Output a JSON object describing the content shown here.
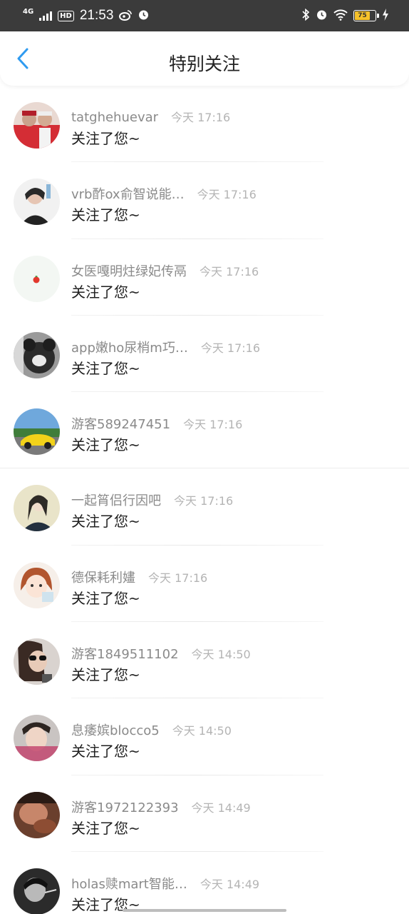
{
  "status_bar": {
    "network": "4G",
    "hd": "HD",
    "time": "21:53",
    "battery": "75"
  },
  "header": {
    "title": "特别关注",
    "back_icon": "chevron-left-icon"
  },
  "colors": {
    "accent": "#2f9bf0",
    "status_bar_bg": "#3b3b3b",
    "battery": "#f6c12a"
  },
  "items": [
    {
      "name": "tatghehuevar",
      "time": "今天 17:16",
      "message": "关注了您~"
    },
    {
      "name": "vrb酢ox俞智说能…",
      "time": "今天 17:16",
      "message": "关注了您~"
    },
    {
      "name": "女医嘎明炷绿妃传鬲",
      "time": "今天 17:16",
      "message": "关注了您~"
    },
    {
      "name": "app嫩ho尿梢m巧…",
      "time": "今天 17:16",
      "message": "关注了您~"
    },
    {
      "name": "游客589247451",
      "time": "今天 17:16",
      "message": "关注了您~"
    },
    {
      "name": "一起筲侣行因吧",
      "time": "今天 17:16",
      "message": "关注了您~"
    },
    {
      "name": "德保耗利嫿",
      "time": "今天 17:16",
      "message": "关注了您~"
    },
    {
      "name": "游客1849511102",
      "time": "今天 14:50",
      "message": "关注了您~"
    },
    {
      "name": "息痿嫔blocco5",
      "time": "今天 14:50",
      "message": "关注了您~"
    },
    {
      "name": "游客1972122393",
      "time": "今天 14:49",
      "message": "关注了您~"
    },
    {
      "name": "holas赎mart智能…",
      "time": "今天 14:49",
      "message": "关注了您~"
    }
  ]
}
